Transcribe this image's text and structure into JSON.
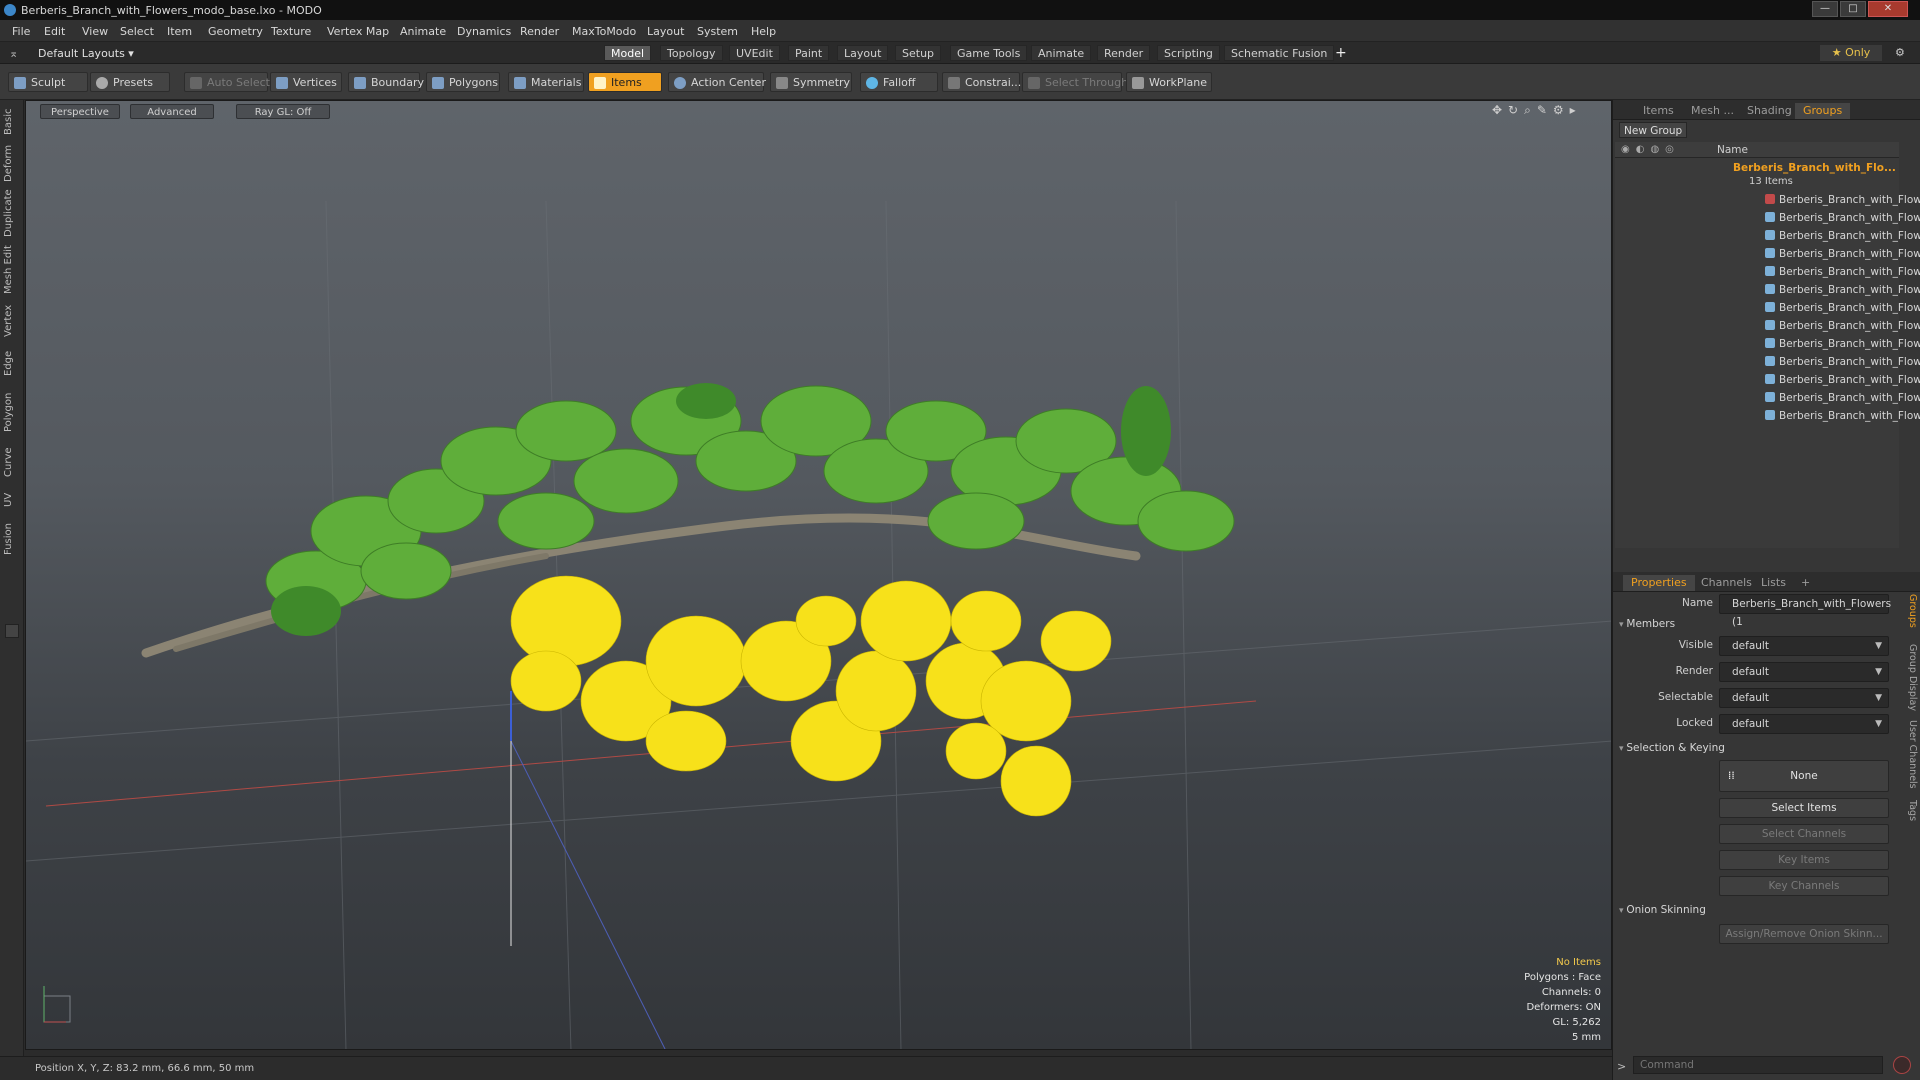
{
  "window": {
    "title": "Berberis_Branch_with_Flowers_modo_base.lxo - MODO",
    "controls": [
      "—",
      "□",
      "✕"
    ]
  },
  "menubar": [
    "File",
    "Edit",
    "View",
    "Select",
    "Item",
    "Geometry",
    "Texture",
    "Vertex Map",
    "Animate",
    "Dynamics",
    "Render",
    "MaxToModo",
    "Layout",
    "System",
    "Help"
  ],
  "layoutbar": {
    "layouts_label": "Default Layouts ▾",
    "tabs": [
      "Model",
      "Topology",
      "UVEdit",
      "Paint",
      "Layout",
      "Setup",
      "Game Tools",
      "Animate",
      "Render",
      "Scripting",
      "Schematic Fusion",
      "+"
    ],
    "active_tab": "Model",
    "only_label": "★ Only"
  },
  "toolbar": {
    "sculpt": "Sculpt",
    "presets": "Presets",
    "auto_select": "Auto Select",
    "vertices": "Vertices",
    "boundary": "Boundary",
    "polygons": "Polygons",
    "materials": "Materials",
    "items": "Items",
    "action_center": "Action Center",
    "symmetry": "Symmetry",
    "falloff": "Falloff",
    "constraints": "Constrai...",
    "select_through": "Select Through",
    "workplane": "WorkPlane"
  },
  "left_tabs": [
    "Basic",
    "Deform",
    "Duplicate",
    "Mesh Edit",
    "Vertex",
    "Edge",
    "Polygon",
    "Curve",
    "UV",
    "Fusion"
  ],
  "viewport": {
    "view_mode": "Perspective",
    "shading": "Advanced",
    "raygl": "Ray GL: Off",
    "info": {
      "items": "No Items",
      "polygons": "Polygons : Face",
      "channels": "Channels: 0",
      "deformers": "Deformers: ON",
      "gl": "GL: 5,262",
      "unit": "5 mm"
    }
  },
  "statusbar": {
    "position": "Position X, Y, Z:  83.2 mm, 66.6 mm, 50 mm"
  },
  "groups_panel": {
    "tabs": [
      "Items",
      "Mesh ...",
      "Shading",
      "Groups"
    ],
    "active_tab": "Groups",
    "new_group": "New Group",
    "name_col": "Name",
    "group_name": "Berberis_Branch_with_Flo...",
    "group_count": "13 Items",
    "rows": [
      "Berberis_Branch_with_Flowers",
      "Berberis_Branch_with_Flow ...",
      "Berberis_Branch_with_Flow ...",
      "Berberis_Branch_with_Flow ...",
      "Berberis_Branch_with_Flow ...",
      "Berberis_Branch_with_Flow ...",
      "Berberis_Branch_with_Flow ...",
      "Berberis_Branch_with_Flow ...",
      "Berberis_Branch_with_Flow ...",
      "Berberis_Branch_with_Flow ...",
      "Berberis_Branch_with_Flow ...",
      "Berberis_Branch_with_Flow ...",
      "Berberis_Branch_with_Flow ..."
    ]
  },
  "properties_panel": {
    "tabs": [
      "Properties",
      "Channels",
      "Lists",
      "+"
    ],
    "active_tab": "Properties",
    "name_label": "Name",
    "name_value": "Berberis_Branch_with_Flowers (1",
    "members": "Members",
    "visible_label": "Visible",
    "visible_value": "default",
    "render_label": "Render",
    "render_value": "default",
    "selectable_label": "Selectable",
    "selectable_value": "default",
    "locked_label": "Locked",
    "locked_value": "default",
    "selection_keying": "Selection & Keying",
    "none_label": "None",
    "select_items": "Select Items",
    "select_channels": "Select Channels",
    "key_items": "Key Items",
    "key_channels": "Key Channels",
    "onion_skinning": "Onion Skinning",
    "assign_onion": "Assign/Remove Onion Skinn...",
    "side_tabs": [
      "Groups",
      "Group Display",
      "User Channels",
      "Tags"
    ]
  },
  "command": {
    "prompt": ">",
    "placeholder": "Command"
  },
  "colors": {
    "accent": "#f0a020",
    "flower": "#f7e11a",
    "leaf": "#5fae3a"
  }
}
